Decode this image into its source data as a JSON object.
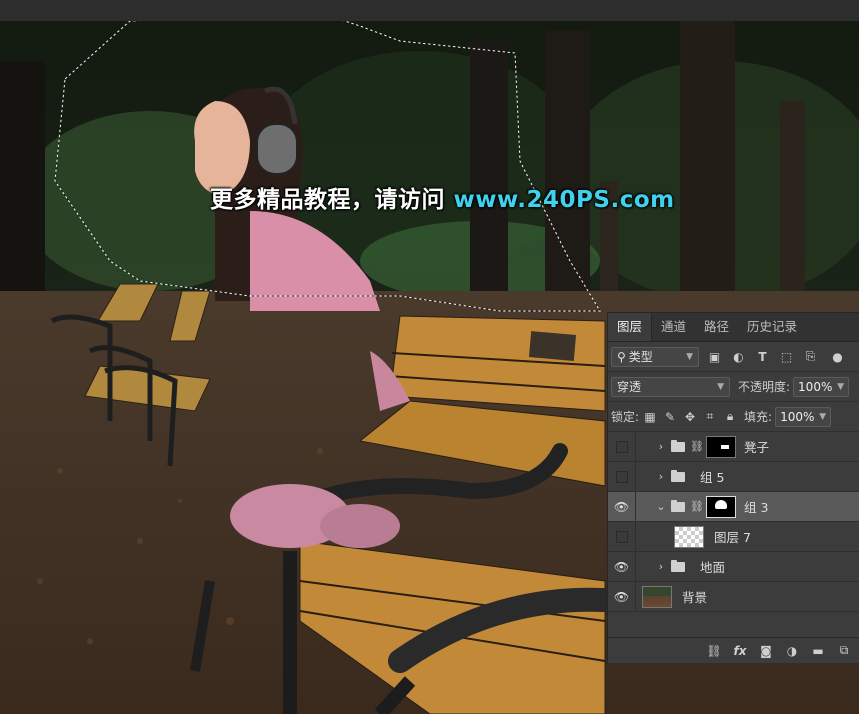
{
  "watermark": {
    "text": "更多精品教程，请访问 ",
    "url": "www.240PS.com"
  },
  "layers_panel": {
    "tabs": [
      "图层",
      "通道",
      "路径",
      "历史记录"
    ],
    "active_tab": "图层",
    "filter": {
      "kind_label": "类型"
    },
    "blend_mode": "穿透",
    "opacity_label": "不透明度:",
    "opacity_value": "100%",
    "lock_label": "锁定:",
    "fill_label": "填充:",
    "fill_value": "100%",
    "layers": [
      {
        "name": "凳子",
        "type": "group-with-mask",
        "visible": false,
        "active": false
      },
      {
        "name": "组 5",
        "type": "group",
        "visible": false,
        "active": false
      },
      {
        "name": "组 3",
        "type": "group-with-mask",
        "visible": true,
        "active": true,
        "expanded": true
      },
      {
        "name": "图层 7",
        "type": "pixel-transparent",
        "visible": false,
        "active": false
      },
      {
        "name": "地面",
        "type": "group",
        "visible": true,
        "active": false
      },
      {
        "name": "背景",
        "type": "pixel-photo",
        "visible": true,
        "active": false
      }
    ],
    "footer_icons": [
      "link-icon",
      "fx-icon",
      "mask-icon",
      "adjustment-icon",
      "new-group-icon",
      "new-layer-icon"
    ]
  }
}
